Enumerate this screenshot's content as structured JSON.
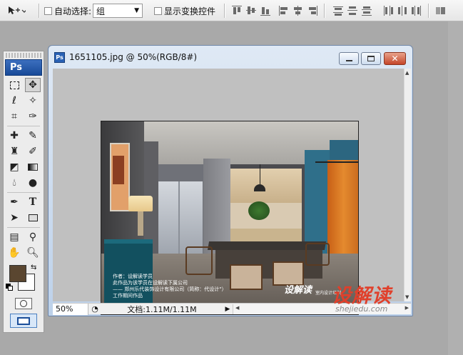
{
  "options_bar": {
    "auto_select_label": "自动选择:",
    "auto_select_value": "组",
    "show_transform_label": "显示变换控件"
  },
  "toolbox": {
    "logo": "Ps"
  },
  "document": {
    "title": "1651105.jpg @ 50%(RGB/8#)",
    "zoom": "50%",
    "status": "文档:1.11M/1.11M"
  },
  "photo_text": {
    "line1": "作者：设解读学员",
    "line2": "此作品为该学员在设解读下属公司",
    "line3": "—— 郑州乐代装饰设计有限公司（简称：代设计\"）",
    "line4": "工作期间作品",
    "logo": "设解读",
    "logo_sub": "室内设计培训"
  },
  "watermark": {
    "logo": "设解读",
    "url": "shejiedu.com"
  },
  "colors": {
    "foreground": "#5a4630",
    "background": "#ffffff",
    "accent_wall": "#2f6f8a",
    "door": "#d9731f"
  }
}
